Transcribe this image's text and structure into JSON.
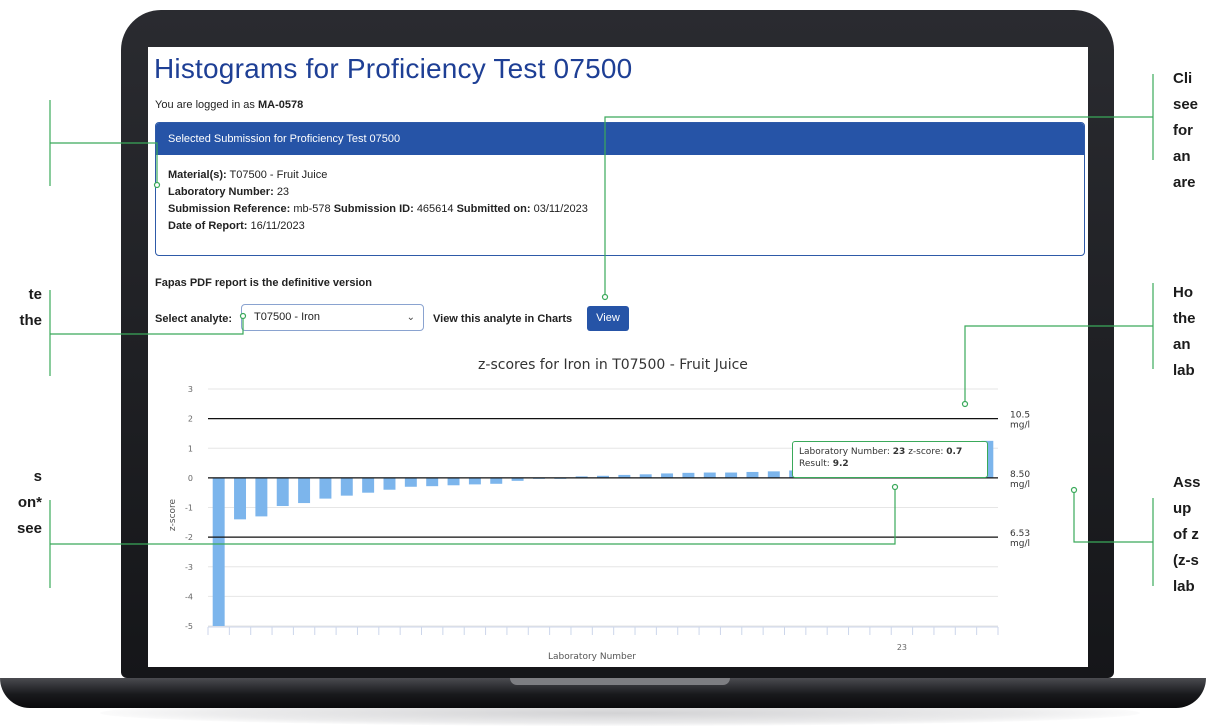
{
  "page": {
    "title": "Histograms for Proficiency Test 07500",
    "logged_prefix": "You are logged in as",
    "user": "MA-0578"
  },
  "panel": {
    "heading": "Selected Submission for Proficiency Test 07500",
    "material_label": "Material(s):",
    "material_value": "T07500 - Fruit Juice",
    "lab_label": "Laboratory Number:",
    "lab_value": "23",
    "subref_label": "Submission Reference:",
    "subref_value": "mb-578",
    "subid_label": "Submission ID:",
    "subid_value": "465614",
    "submitted_label": "Submitted on:",
    "submitted_value": "03/11/2023",
    "report_label": "Date of Report:",
    "report_value": "16/11/2023"
  },
  "definitive_note": "Fapas PDF report is the definitive version",
  "selector": {
    "label": "Select analyte:",
    "value": "T07500 - Iron",
    "charts_label": "View this analyte in Charts",
    "view_button": "View"
  },
  "chart_data": {
    "type": "bar",
    "title": "z-scores for Iron in T07500 - Fruit Juice",
    "xlabel": "Laboratory Number",
    "ylabel": "z-score",
    "ylim": [
      -5,
      3
    ],
    "yticks": [
      3,
      2,
      1,
      0,
      -1,
      -2,
      -3,
      -4,
      -5
    ],
    "categories": [
      "",
      "",
      "",
      "",
      "",
      "",
      "",
      "",
      "",
      "",
      "",
      "",
      "",
      "",
      "",
      "",
      "",
      "",
      "",
      "",
      "",
      "",
      "",
      "",
      "",
      "",
      "",
      "",
      "",
      "",
      "",
      "",
      "23",
      "",
      "",
      "",
      ""
    ],
    "values": [
      -5.0,
      -1.4,
      -1.3,
      -0.95,
      -0.85,
      -0.7,
      -0.6,
      -0.5,
      -0.4,
      -0.3,
      -0.28,
      -0.25,
      -0.22,
      -0.2,
      -0.1,
      0.0,
      0.0,
      0.05,
      0.07,
      0.1,
      0.12,
      0.15,
      0.17,
      0.18,
      0.18,
      0.2,
      0.22,
      0.25,
      0.28,
      0.3,
      0.3,
      0.65,
      0.7,
      0.78,
      0.8,
      0.85,
      1.25
    ],
    "highlight_index": 32,
    "bar_color": "#7cb5ec",
    "highlight_color": "#2db84d",
    "reference_lines": [
      {
        "z": 2,
        "label_value": "10.5",
        "label_unit": "mg/l"
      },
      {
        "z": 0,
        "label_value": "8.50",
        "label_unit": "mg/l"
      },
      {
        "z": -2,
        "label_value": "6.53",
        "label_unit": "mg/l"
      }
    ],
    "tooltip": {
      "lab_label": "Laboratory Number:",
      "lab_value": "23",
      "z_label": "z-score:",
      "z_value": "0.7",
      "result_label": "Result:",
      "result_value": "9.2"
    }
  },
  "annotations": {
    "left": [
      {
        "lines": [
          "te",
          "the"
        ]
      },
      {
        "lines": [
          "s",
          "on*",
          "see"
        ]
      }
    ],
    "right": [
      {
        "lines": [
          "Cli",
          "see",
          "for",
          "an",
          "are"
        ]
      },
      {
        "lines": [
          "Ho",
          "the",
          "an",
          "lab"
        ]
      },
      {
        "lines": [
          "Ass",
          "up",
          "of z",
          "(z-s",
          "lab"
        ]
      }
    ]
  },
  "colors": {
    "title_blue": "#1e3f95",
    "panel_blue": "#2654a7",
    "callout_green": "#3aa95a"
  }
}
